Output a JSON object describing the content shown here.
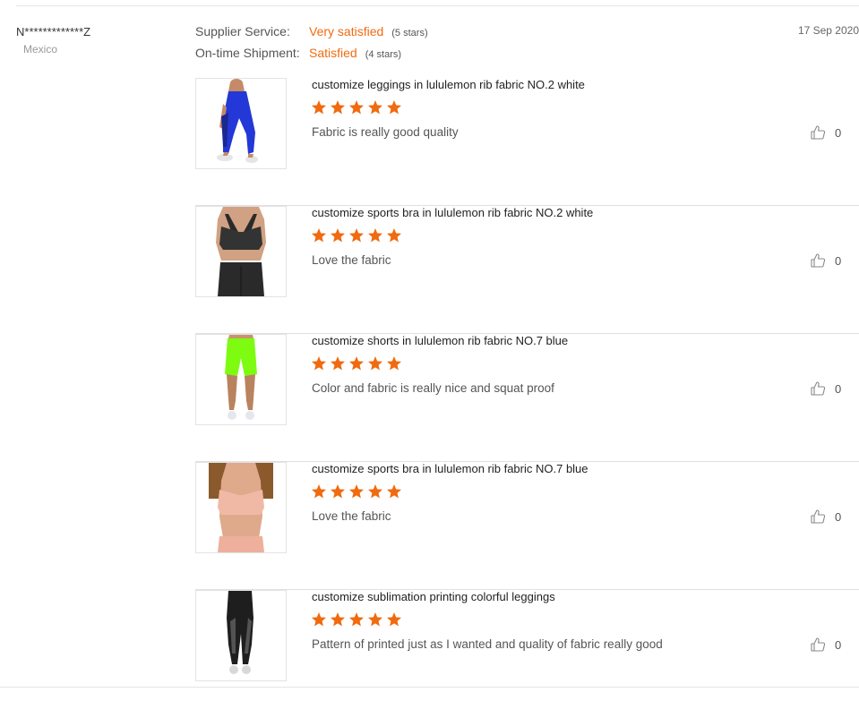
{
  "buyer": {
    "name": "N*************Z",
    "country": "Mexico"
  },
  "ratings": [
    {
      "label": "Supplier Service:",
      "value": "Very satisfied",
      "stars_text": "(5 stars)"
    },
    {
      "label": "On-time Shipment:",
      "value": "Satisfied",
      "stars_text": "(4 stars)"
    }
  ],
  "date": "17 Sep 2020",
  "colors": {
    "accent": "#f06b10",
    "star": "#f06b10"
  },
  "items": [
    {
      "title": "customize leggings in lululemon rib fabric NO.2 white",
      "rating": 5,
      "comment": "Fabric is really good quality",
      "likes": "0",
      "thumb_icon": "blue-leggings-photo"
    },
    {
      "title": "customize sports bra in lululemon rib fabric NO.2 white",
      "rating": 5,
      "comment": "Love the fabric",
      "likes": "0",
      "thumb_icon": "black-sports-bra-photo"
    },
    {
      "title": "customize shorts in lululemon rib fabric NO.7 blue",
      "rating": 5,
      "comment": "Color and fabric is really nice and squat proof",
      "likes": "0",
      "thumb_icon": "neon-shorts-photo"
    },
    {
      "title": "customize sports bra in lululemon rib fabric NO.7 blue",
      "rating": 5,
      "comment": "Love the fabric",
      "likes": "0",
      "thumb_icon": "pink-sports-bra-photo"
    },
    {
      "title": "customize sublimation printing colorful leggings",
      "rating": 5,
      "comment": "Pattern of printed just as I wanted and quality of fabric really good",
      "likes": "0",
      "thumb_icon": "black-mesh-leggings-photo"
    }
  ]
}
